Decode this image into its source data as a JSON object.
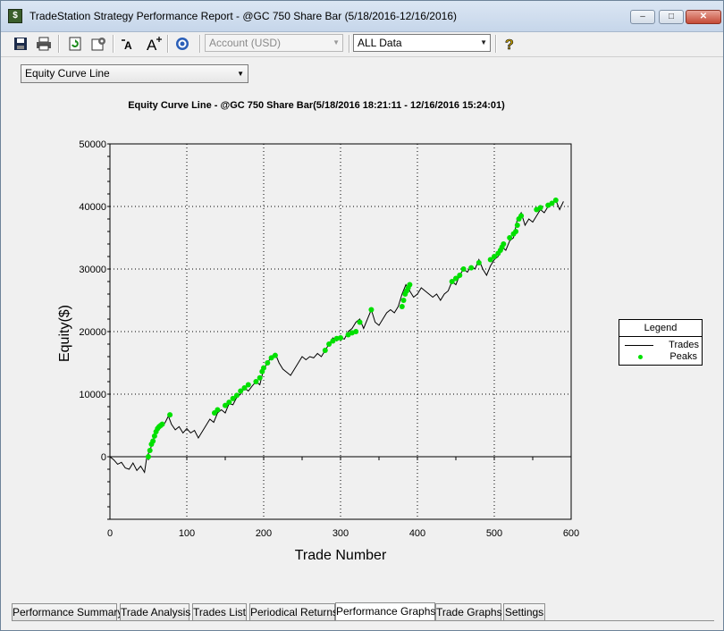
{
  "window": {
    "title": "TradeStation Strategy Performance Report - @GC 750 Share Bar (5/18/2016-12/16/2016)",
    "controls": {
      "minimize": "–",
      "maximize": "□",
      "close": "✕"
    }
  },
  "toolbar": {
    "icons": [
      "save-icon",
      "print-icon",
      "refresh-icon",
      "settings-icon",
      "decrease-font-icon",
      "increase-font-icon",
      "target-icon",
      "help-icon"
    ],
    "account_combo": "Account (USD)",
    "data_combo": "ALL Data"
  },
  "view_select": {
    "value": "Equity Curve Line"
  },
  "legend": {
    "title": "Legend",
    "items": [
      "Trades",
      "Peaks"
    ]
  },
  "colors": {
    "peaks": "#00e000",
    "trades": "#000000"
  },
  "tabs": [
    "Performance Summary",
    "Trade Analysis",
    "Trades List",
    "Periodical Returns",
    "Performance Graphs",
    "Trade Graphs",
    "Settings"
  ],
  "active_tab": "Performance Graphs",
  "chart_data": {
    "type": "line",
    "title": "Equity Curve Line - @GC 750 Share Bar(5/18/2016 18:21:11 - 12/16/2016 15:24:01)",
    "xlabel": "Trade Number",
    "ylabel": "Equity($)",
    "xlim": [
      0,
      600
    ],
    "ylim": [
      -10000,
      50000
    ],
    "x_ticks": [
      0,
      100,
      200,
      300,
      400,
      500,
      600
    ],
    "y_ticks": [
      0,
      10000,
      20000,
      30000,
      40000,
      50000
    ],
    "grid": true,
    "legend_position": "right",
    "series": [
      {
        "name": "Trades",
        "x": [
          0,
          5,
          10,
          15,
          20,
          25,
          30,
          35,
          40,
          45,
          48,
          52,
          56,
          60,
          64,
          68,
          72,
          76,
          80,
          85,
          90,
          95,
          100,
          105,
          110,
          115,
          120,
          125,
          130,
          135,
          140,
          145,
          150,
          155,
          160,
          165,
          170,
          175,
          180,
          185,
          190,
          195,
          200,
          205,
          210,
          215,
          220,
          225,
          230,
          235,
          240,
          245,
          250,
          255,
          260,
          265,
          270,
          275,
          280,
          285,
          290,
          295,
          300,
          305,
          310,
          315,
          320,
          325,
          330,
          335,
          340,
          345,
          350,
          355,
          360,
          365,
          370,
          375,
          380,
          385,
          390,
          395,
          400,
          405,
          410,
          415,
          420,
          425,
          430,
          435,
          440,
          445,
          450,
          455,
          460,
          465,
          470,
          475,
          480,
          485,
          490,
          495,
          500,
          505,
          510,
          515,
          520,
          525,
          530,
          535,
          540,
          545,
          550,
          555,
          560,
          565,
          570,
          575,
          580,
          585,
          590
        ],
        "y": [
          0,
          -500,
          -1200,
          -900,
          -1800,
          -2000,
          -1000,
          -2200,
          -1500,
          -2500,
          0,
          1000,
          2500,
          4000,
          5000,
          4800,
          5500,
          6500,
          5200,
          4300,
          4800,
          3800,
          4500,
          3800,
          4200,
          3000,
          4000,
          5000,
          6000,
          5500,
          7000,
          7500,
          7000,
          8500,
          8300,
          9500,
          10000,
          11000,
          10500,
          11300,
          12000,
          11500,
          14000,
          15000,
          16000,
          16500,
          15000,
          14000,
          13500,
          13000,
          14000,
          15000,
          16000,
          15500,
          16000,
          15800,
          16500,
          16000,
          17000,
          18000,
          19000,
          18500,
          19000,
          18800,
          20000,
          20500,
          21500,
          22000,
          20500,
          22000,
          23500,
          21500,
          21000,
          22000,
          23000,
          23500,
          23000,
          24000,
          26000,
          27500,
          26500,
          25500,
          26000,
          27000,
          26500,
          26000,
          25500,
          26000,
          25000,
          26000,
          26500,
          28000,
          27500,
          29000,
          30000,
          29500,
          30500,
          30000,
          31500,
          30000,
          29000,
          30500,
          31500,
          32000,
          33500,
          33000,
          34500,
          35000,
          38000,
          39000,
          37000,
          38000,
          37500,
          38500,
          39500,
          39000,
          40000,
          40500,
          41000,
          39500,
          40800
        ]
      },
      {
        "name": "Peaks",
        "x": [
          50,
          52,
          54,
          56,
          58,
          60,
          62,
          64,
          66,
          68,
          78,
          136,
          140,
          150,
          155,
          160,
          165,
          170,
          175,
          180,
          190,
          195,
          198,
          200,
          205,
          210,
          215,
          280,
          285,
          290,
          295,
          300,
          310,
          315,
          320,
          325,
          340,
          380,
          382,
          384,
          386,
          388,
          390,
          445,
          450,
          455,
          460,
          470,
          480,
          495,
          500,
          505,
          508,
          510,
          512,
          520,
          525,
          528,
          530,
          532,
          535,
          555,
          560,
          570,
          575,
          580
        ],
        "y": [
          0,
          1000,
          2000,
          2500,
          3300,
          4000,
          4500,
          4800,
          5000,
          5200,
          6700,
          7000,
          7500,
          8200,
          8700,
          9300,
          9800,
          10500,
          11000,
          11500,
          12000,
          12600,
          13600,
          14200,
          15000,
          15800,
          16200,
          17000,
          18000,
          18500,
          18900,
          19000,
          19500,
          19800,
          20000,
          21500,
          23500,
          24000,
          25000,
          26000,
          26500,
          27000,
          27500,
          28000,
          28500,
          29000,
          30000,
          30200,
          31000,
          31500,
          32000,
          32500,
          33000,
          33500,
          34000,
          35000,
          35600,
          36000,
          37000,
          38000,
          38500,
          39500,
          39800,
          40200,
          40500,
          41000
        ]
      }
    ]
  }
}
